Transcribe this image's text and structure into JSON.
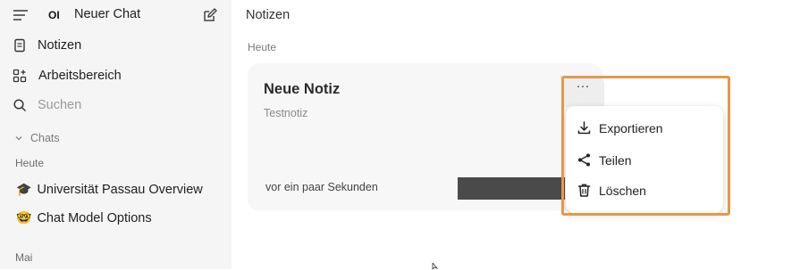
{
  "sidebar": {
    "logo_text": "OI",
    "new_chat_label": "Neuer Chat",
    "nav": [
      {
        "label": "Notizen",
        "icon": "note-icon"
      },
      {
        "label": "Arbeitsbereich",
        "icon": "workspace-icon"
      }
    ],
    "search_placeholder": "Suchen",
    "chats_label": "Chats",
    "today_label": "Heute",
    "chats_today": [
      {
        "emoji": "🎓",
        "label": "Universität Passau Overview"
      },
      {
        "emoji": "🤓",
        "label": "Chat Model Options"
      }
    ],
    "may_label": "Mai"
  },
  "main": {
    "title": "Notizen",
    "group_label": "Heute",
    "note": {
      "title": "Neue Notiz",
      "subtitle": "Testnotiz",
      "time": "vor ein paar Sekunden",
      "more_glyph": "···"
    }
  },
  "menu": {
    "items": [
      {
        "label": "Exportieren",
        "icon": "download-icon"
      },
      {
        "label": "Teilen",
        "icon": "share-icon"
      },
      {
        "label": "Löschen",
        "icon": "trash-icon"
      }
    ]
  },
  "colors": {
    "sidebar_bg": "#f5f5f5",
    "card_bg": "#f7f7f7",
    "highlight": "#e8974a"
  }
}
